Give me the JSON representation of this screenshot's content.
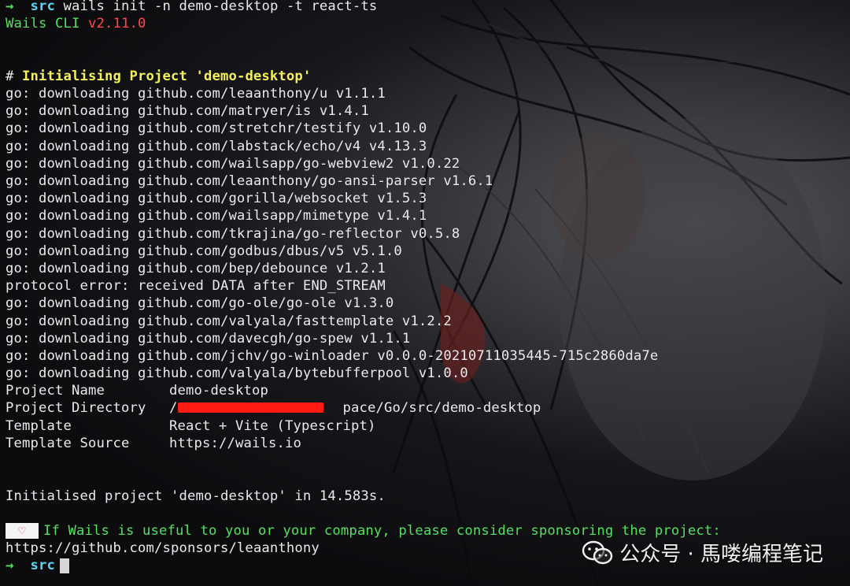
{
  "terminal": {
    "prompt_arrow": "→",
    "prompt_dir": "src",
    "command": "wails init -n demo-desktop -t react-ts",
    "cli_name": "Wails CLI",
    "cli_version": "v2.11.0",
    "section_hash": "#",
    "section_title": "Initialising Project 'demo-desktop'",
    "download_lines": [
      "go: downloading github.com/leaanthony/u v1.1.1",
      "go: downloading github.com/matryer/is v1.4.1",
      "go: downloading github.com/stretchr/testify v1.10.0",
      "go: downloading github.com/labstack/echo/v4 v4.13.3",
      "go: downloading github.com/wailsapp/go-webview2 v1.0.22",
      "go: downloading github.com/leaanthony/go-ansi-parser v1.6.1",
      "go: downloading github.com/gorilla/websocket v1.5.3",
      "go: downloading github.com/wailsapp/mimetype v1.4.1",
      "go: downloading github.com/tkrajina/go-reflector v0.5.8",
      "go: downloading github.com/godbus/dbus/v5 v5.1.0",
      "go: downloading github.com/bep/debounce v1.2.1",
      "protocol error: received DATA after END_STREAM",
      "go: downloading github.com/go-ole/go-ole v1.3.0",
      "go: downloading github.com/valyala/fasttemplate v1.2.2",
      "go: downloading github.com/davecgh/go-spew v1.1.1",
      "go: downloading github.com/jchv/go-winloader v0.0.0-20210711035445-715c2860da7e",
      "go: downloading github.com/valyala/bytebufferpool v1.0.0"
    ],
    "project_info": [
      {
        "key": "Project Name",
        "value": "demo-desktop"
      },
      {
        "key": "Project Directory",
        "value": "/                    pace/Go/src/demo-desktop"
      },
      {
        "key": "Template",
        "value": "React + Vite (Typescript)"
      },
      {
        "key": "Template Source",
        "value": "https://wails.io"
      }
    ],
    "initialised_message": "Initialised project 'demo-desktop' in 14.583s.",
    "heart_icon": "♡",
    "sponsor_message": "If Wails is useful to you or your company, please consider sponsoring the project:",
    "sponsor_url": "https://github.com/sponsors/leaanthony",
    "final_prompt_arrow": "→",
    "final_prompt_dir": "src"
  },
  "watermark": {
    "icon": "wechat-icon",
    "text": "公众号 · 馬喽编程笔记"
  },
  "colors": {
    "green": "#53e05c",
    "red": "#ff4a4a",
    "yellow": "#f4f05c",
    "redaction": "#ff1a12"
  }
}
